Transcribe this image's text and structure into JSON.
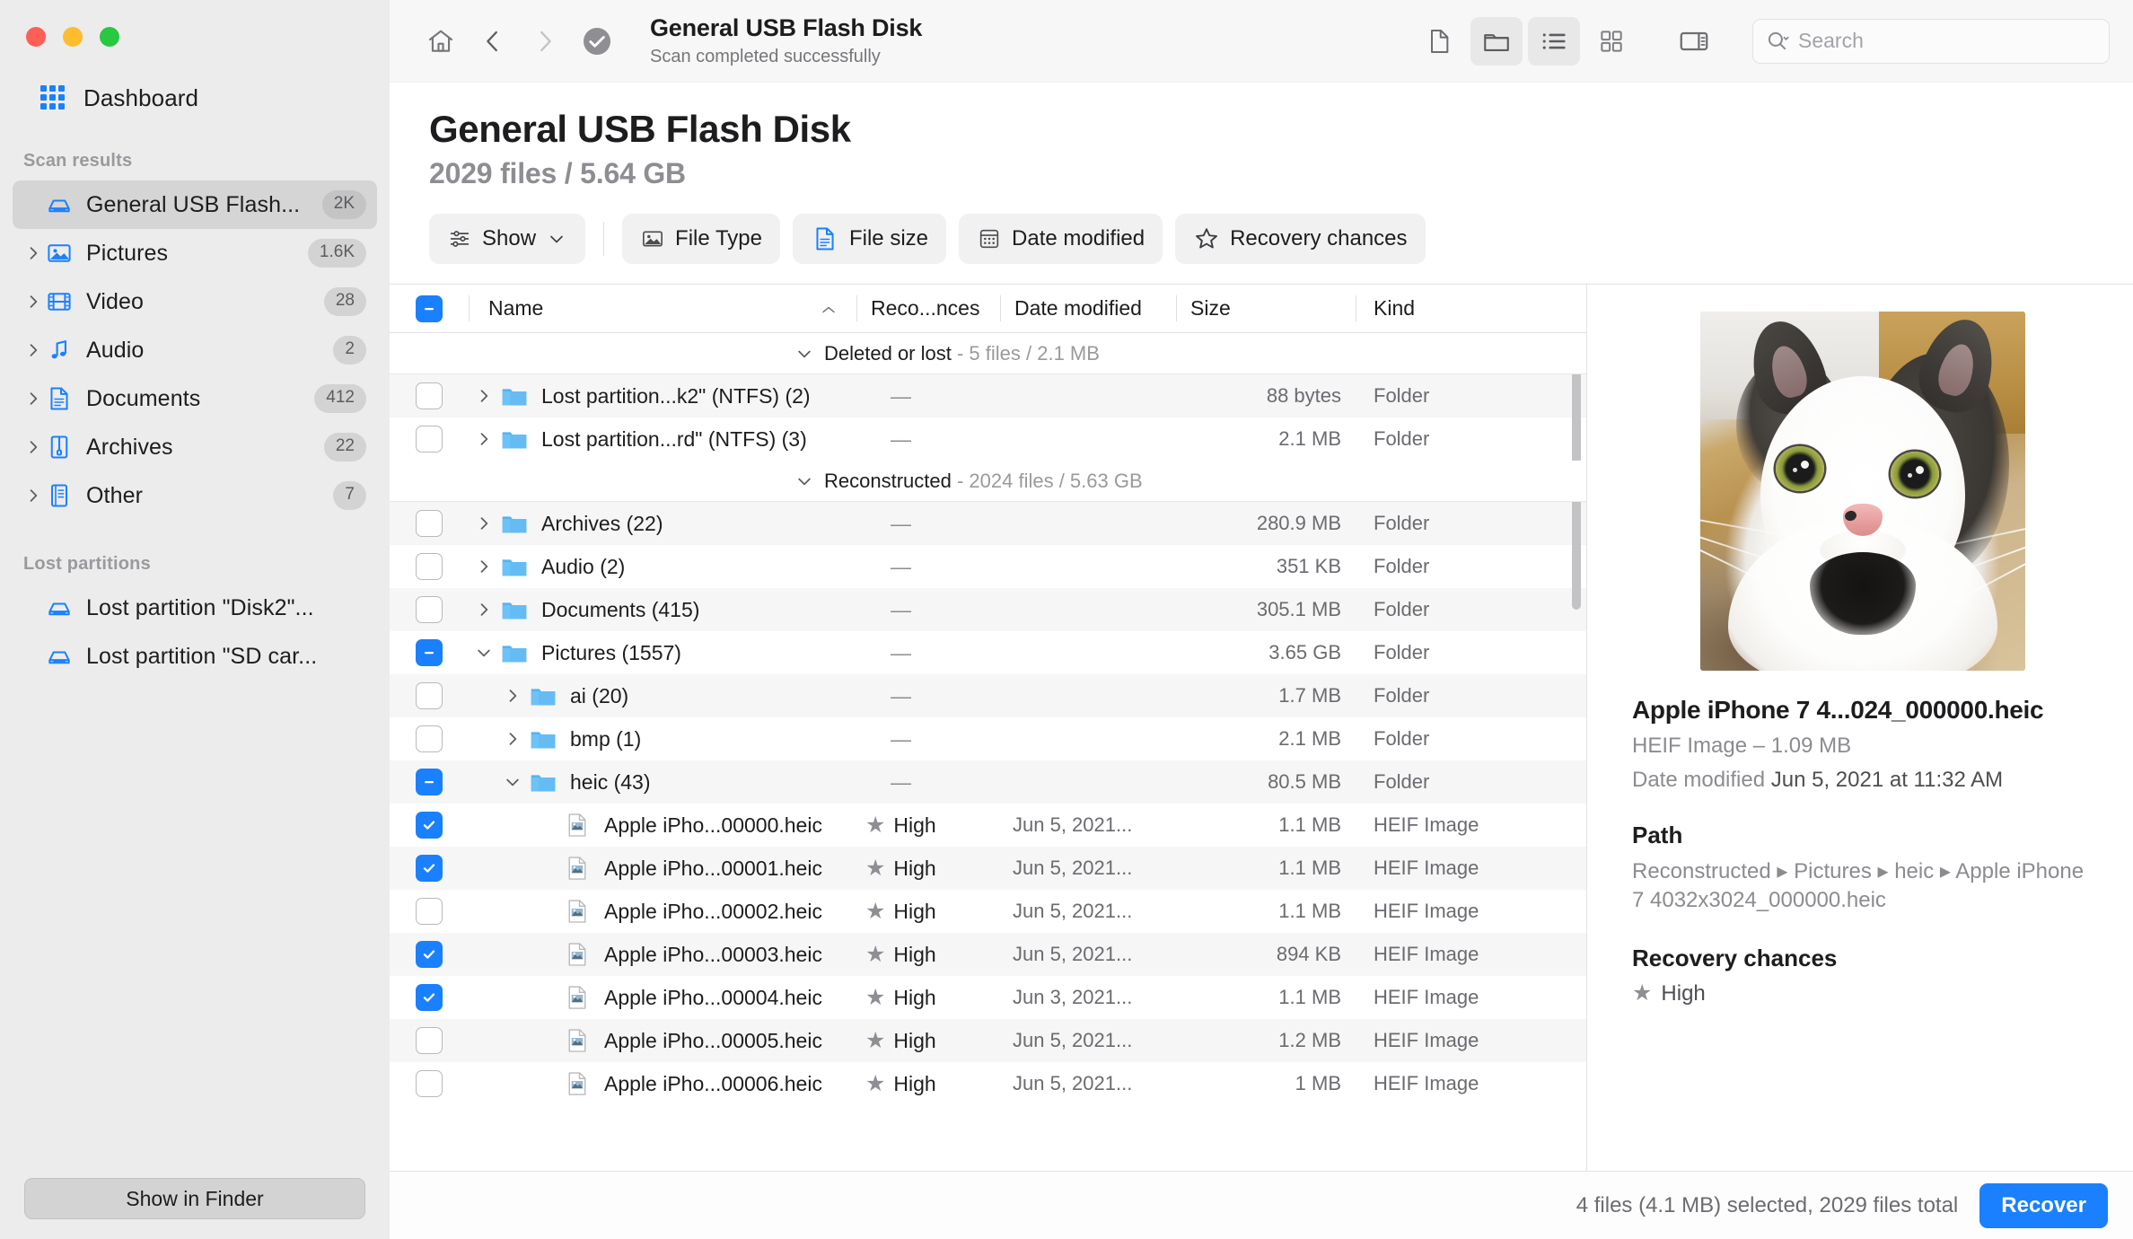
{
  "window": {
    "traffic_lights": [
      "close",
      "minimize",
      "zoom"
    ]
  },
  "sidebar": {
    "dashboard_label": "Dashboard",
    "scan_results_title": "Scan results",
    "lost_partitions_title": "Lost partitions",
    "scan_results": [
      {
        "label": "General USB Flash...",
        "count": "2K",
        "icon": "disk-icon",
        "expandable": false,
        "selected": true
      },
      {
        "label": "Pictures",
        "count": "1.6K",
        "icon": "pictures-icon",
        "expandable": true,
        "selected": false
      },
      {
        "label": "Video",
        "count": "28",
        "icon": "video-icon",
        "expandable": true,
        "selected": false
      },
      {
        "label": "Audio",
        "count": "2",
        "icon": "audio-icon",
        "expandable": true,
        "selected": false
      },
      {
        "label": "Documents",
        "count": "412",
        "icon": "document-icon",
        "expandable": true,
        "selected": false
      },
      {
        "label": "Archives",
        "count": "22",
        "icon": "archive-icon",
        "expandable": true,
        "selected": false
      },
      {
        "label": "Other",
        "count": "7",
        "icon": "other-icon",
        "expandable": true,
        "selected": false
      }
    ],
    "lost_partitions": [
      {
        "label": "Lost partition \"Disk2\"...",
        "icon": "disk-icon"
      },
      {
        "label": "Lost partition \"SD car...",
        "icon": "disk-icon"
      }
    ],
    "show_in_finder_label": "Show in Finder"
  },
  "toolbar": {
    "title": "General USB Flash Disk",
    "subtitle": "Scan completed successfully",
    "nav": [
      "home-icon",
      "back-chevron-icon",
      "forward-chevron-icon",
      "checkmark-circle-icon"
    ],
    "view_buttons": [
      "file-view-icon",
      "folder-view-icon",
      "list-view-icon",
      "grid-view-icon",
      "sidebar-toggle-icon"
    ],
    "active_view_buttons": [
      "folder-view-icon",
      "list-view-icon"
    ],
    "search_placeholder": "Search"
  },
  "page": {
    "title": "General USB Flash Disk",
    "subtitle": "2029 files / 5.64 GB"
  },
  "filters": [
    {
      "label": "Show",
      "icon": "sliders-icon",
      "chevron": true
    },
    {
      "label": "File Type",
      "icon": "image-icon",
      "chevron": false
    },
    {
      "label": "File size",
      "icon": "document-icon",
      "chevron": false
    },
    {
      "label": "Date modified",
      "icon": "calendar-icon",
      "chevron": false
    },
    {
      "label": "Recovery chances",
      "icon": "star-icon",
      "chevron": false
    }
  ],
  "table": {
    "header_checkbox_state": "mixed",
    "columns": [
      {
        "key": "name",
        "label": "Name",
        "sorted": "asc"
      },
      {
        "key": "reco",
        "label": "Reco...nces"
      },
      {
        "key": "date",
        "label": "Date modified"
      },
      {
        "key": "size",
        "label": "Size"
      },
      {
        "key": "kind",
        "label": "Kind"
      }
    ],
    "rows": [
      {
        "type": "group",
        "label": "Deleted or lost",
        "meta": "5 files / 2.1 MB",
        "expanded": true
      },
      {
        "type": "item",
        "check": "off",
        "indent": 1,
        "twisty": "collapsed",
        "icon": "folder-icon",
        "name": "Lost partition...k2\" (NTFS) (2)",
        "reco": "",
        "date": "",
        "size": "88 bytes",
        "kind": "Folder",
        "dash": true
      },
      {
        "type": "item",
        "check": "off",
        "indent": 1,
        "twisty": "collapsed",
        "icon": "folder-icon",
        "name": "Lost partition...rd\" (NTFS) (3)",
        "reco": "",
        "date": "",
        "size": "2.1 MB",
        "kind": "Folder",
        "dash": true
      },
      {
        "type": "group",
        "label": "Reconstructed",
        "meta": "2024 files / 5.63 GB",
        "expanded": true
      },
      {
        "type": "item",
        "check": "off",
        "indent": 1,
        "twisty": "collapsed",
        "icon": "folder-icon",
        "name": "Archives (22)",
        "reco": "",
        "date": "",
        "size": "280.9 MB",
        "kind": "Folder",
        "dash": true
      },
      {
        "type": "item",
        "check": "off",
        "indent": 1,
        "twisty": "collapsed",
        "icon": "folder-icon",
        "name": "Audio (2)",
        "reco": "",
        "date": "",
        "size": "351 KB",
        "kind": "Folder",
        "dash": true
      },
      {
        "type": "item",
        "check": "off",
        "indent": 1,
        "twisty": "collapsed",
        "icon": "folder-icon",
        "name": "Documents (415)",
        "reco": "",
        "date": "",
        "size": "305.1 MB",
        "kind": "Folder",
        "dash": true
      },
      {
        "type": "item",
        "check": "mixed",
        "indent": 1,
        "twisty": "expanded",
        "icon": "folder-icon",
        "name": "Pictures (1557)",
        "reco": "",
        "date": "",
        "size": "3.65 GB",
        "kind": "Folder",
        "dash": true
      },
      {
        "type": "item",
        "check": "off",
        "indent": 2,
        "twisty": "collapsed",
        "icon": "folder-icon",
        "name": "ai (20)",
        "reco": "",
        "date": "",
        "size": "1.7 MB",
        "kind": "Folder",
        "dash": true
      },
      {
        "type": "item",
        "check": "off",
        "indent": 2,
        "twisty": "collapsed",
        "icon": "folder-icon",
        "name": "bmp (1)",
        "reco": "",
        "date": "",
        "size": "2.1 MB",
        "kind": "Folder",
        "dash": true
      },
      {
        "type": "item",
        "check": "mixed",
        "indent": 2,
        "twisty": "expanded",
        "icon": "folder-icon",
        "name": "heic (43)",
        "reco": "",
        "date": "",
        "size": "80.5 MB",
        "kind": "Folder",
        "dash": true
      },
      {
        "type": "item",
        "check": "on",
        "indent": 3,
        "twisty": "none",
        "icon": "heic-file-icon",
        "name": "Apple iPho...00000.heic",
        "reco": "High",
        "date": "Jun 5, 2021...",
        "size": "1.1 MB",
        "kind": "HEIF Image",
        "dash": false
      },
      {
        "type": "item",
        "check": "on",
        "indent": 3,
        "twisty": "none",
        "icon": "heic-file-icon",
        "name": "Apple iPho...00001.heic",
        "reco": "High",
        "date": "Jun 5, 2021...",
        "size": "1.1 MB",
        "kind": "HEIF Image",
        "dash": false
      },
      {
        "type": "item",
        "check": "off",
        "indent": 3,
        "twisty": "none",
        "icon": "heic-file-icon",
        "name": "Apple iPho...00002.heic",
        "reco": "High",
        "date": "Jun 5, 2021...",
        "size": "1.1 MB",
        "kind": "HEIF Image",
        "dash": false
      },
      {
        "type": "item",
        "check": "on",
        "indent": 3,
        "twisty": "none",
        "icon": "heic-file-icon",
        "name": "Apple iPho...00003.heic",
        "reco": "High",
        "date": "Jun 5, 2021...",
        "size": "894 KB",
        "kind": "HEIF Image",
        "dash": false
      },
      {
        "type": "item",
        "check": "on",
        "indent": 3,
        "twisty": "none",
        "icon": "heic-file-icon",
        "name": "Apple iPho...00004.heic",
        "reco": "High",
        "date": "Jun 3, 2021...",
        "size": "1.1 MB",
        "kind": "HEIF Image",
        "dash": false
      },
      {
        "type": "item",
        "check": "off",
        "indent": 3,
        "twisty": "none",
        "icon": "heic-file-icon",
        "name": "Apple iPho...00005.heic",
        "reco": "High",
        "date": "Jun 5, 2021...",
        "size": "1.2 MB",
        "kind": "HEIF Image",
        "dash": false
      },
      {
        "type": "item",
        "check": "off",
        "indent": 3,
        "twisty": "none",
        "icon": "heic-file-icon",
        "name": "Apple iPho...00006.heic",
        "reco": "High",
        "date": "Jun 5, 2021...",
        "size": "1 MB",
        "kind": "HEIF Image",
        "dash": false
      }
    ]
  },
  "preview": {
    "thumbnail_alt": "cat-photo-thumbnail",
    "file_name": "Apple iPhone 7 4...024_000000.heic",
    "file_type_size": "HEIF Image – 1.09 MB",
    "date_modified_label": "Date modified",
    "date_modified_value": "Jun 5, 2021 at 11:32 AM",
    "path_heading": "Path",
    "path_segments": [
      "Reconstructed",
      "Pictures",
      "heic",
      "Apple iPhone 7 4032x3024_000000.heic"
    ],
    "path_text": "Reconstructed ▸ Pictures ▸ heic ▸ Apple iPhone 7 4032x3024_000000.heic",
    "recovery_heading": "Recovery chances",
    "recovery_value": "High"
  },
  "statusbar": {
    "status_text": "4 files (4.1 MB) selected, 2029 files total",
    "recover_label": "Recover"
  },
  "colors": {
    "accent": "#1a80ff",
    "sidebar_bg": "#ececec",
    "selected_row_bg": "#d5d5d5",
    "folder_blue": "#5ab4f0",
    "close_red": "#ff5f57",
    "minimize_yellow": "#febc2e",
    "zoom_green": "#28c840"
  }
}
